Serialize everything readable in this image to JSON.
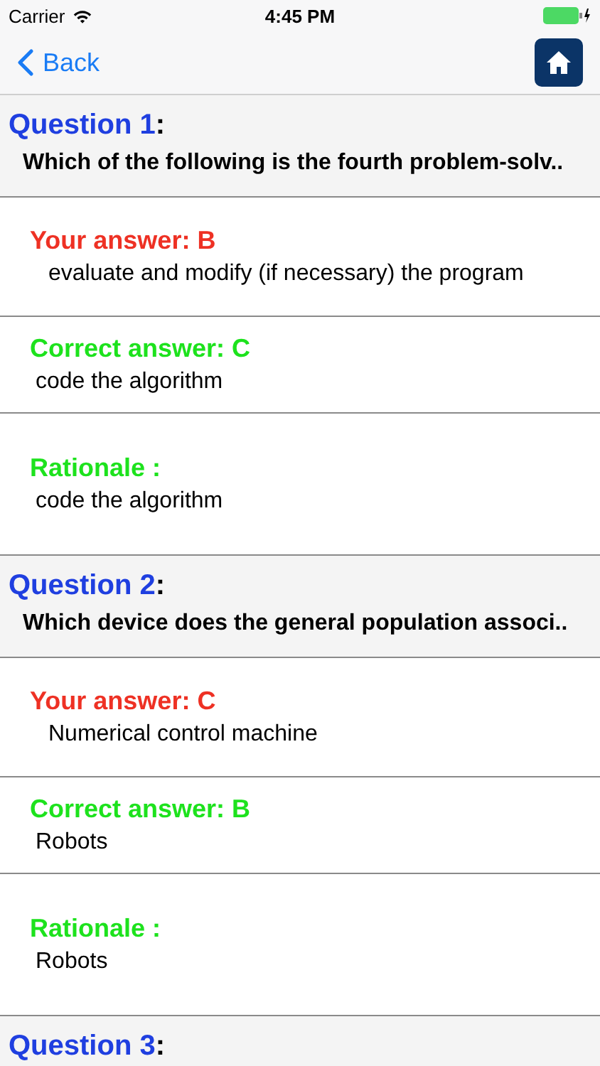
{
  "status_bar": {
    "carrier": "Carrier",
    "time": "4:45 PM"
  },
  "nav": {
    "back": "Back"
  },
  "questions": [
    {
      "label": "Question 1",
      "separator": ":",
      "text": "Which of the following is the fourth problem-solv..",
      "answers": [
        {
          "kind": "yours",
          "heading": "Your answer: B",
          "text": "evaluate and modify (if necessary) the program"
        },
        {
          "kind": "correct",
          "heading": "Correct answer: C",
          "text": "code the algorithm"
        },
        {
          "kind": "rationale",
          "heading": "Rationale :",
          "text": "code the algorithm"
        }
      ]
    },
    {
      "label": "Question 2",
      "separator": ":",
      "text": "Which device does the general population associ..",
      "answers": [
        {
          "kind": "yours",
          "heading": "Your answer: C",
          "text": "Numerical control machine"
        },
        {
          "kind": "correct",
          "heading": "Correct answer: B",
          "text": "Robots"
        },
        {
          "kind": "rationale",
          "heading": "Rationale :",
          "text": "Robots"
        }
      ]
    },
    {
      "label": "Question 3",
      "separator": ":"
    }
  ]
}
